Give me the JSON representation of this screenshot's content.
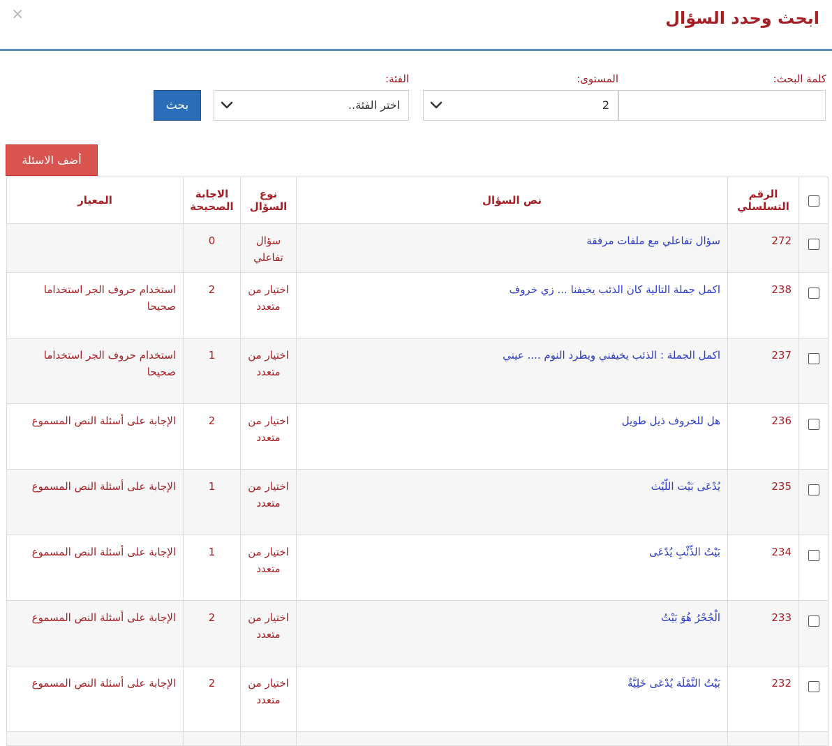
{
  "dialog": {
    "title": "ابحث وحدد السؤال",
    "close_glyph": "×"
  },
  "search": {
    "keyword_label": "كلمة البحث:",
    "keyword_value": "",
    "level_label": "المستوى:",
    "level_value": "2",
    "category_label": "الفئة:",
    "category_value": "اختر الفئة..",
    "search_button": "بحث"
  },
  "add_button": "أضف الاسئلة",
  "table": {
    "headers": {
      "serial": "الرقم التسلسلي",
      "question": "نص السؤال",
      "type": "نوع السؤال",
      "answer": "الاجابة الصحيحة",
      "criterion": "المعيار"
    },
    "rows": [
      {
        "serial": "272",
        "question": "سؤال تفاعلي مع ملفات مرفقة",
        "type": "سؤال تفاعلي",
        "answer": "0",
        "criterion": ""
      },
      {
        "serial": "238",
        "question": "اكمل جملة التالية كان الذئب يخيفنا ... زي خروف",
        "type": "اختيار من متعدد",
        "answer": "2",
        "criterion": "استخدام حروف الجر استخداما صحيحا"
      },
      {
        "serial": "237",
        "question": "اكمل الجملة : الذئب يخيفني ويطرد النوم .... عيني",
        "type": "اختيار من متعدد",
        "answer": "1",
        "criterion": "استخدام حروف الجر استخداما صحيحا"
      },
      {
        "serial": "236",
        "question": "هل للخروف ذيل طويل",
        "type": "اختيار من متعدد",
        "answer": "2",
        "criterion": "الإجابة على أسئلة النص المسموع"
      },
      {
        "serial": "235",
        "question": "يُدْعَى بَيْت اللّيْث",
        "type": "اختيار من متعدد",
        "answer": "1",
        "criterion": "الإجابة على أسئلة النص المسموع"
      },
      {
        "serial": "234",
        "question": "بَيْتُ الذِّئْبِ يُدْعَى",
        "type": "اختيار من متعدد",
        "answer": "1",
        "criterion": "الإجابة على أسئلة النص المسموع"
      },
      {
        "serial": "233",
        "question": "الْجُحْرُ هُوَ بَيْتُ",
        "type": "اختيار من متعدد",
        "answer": "2",
        "criterion": "الإجابة على أسئلة النص المسموع"
      },
      {
        "serial": "232",
        "question": "بَيْتُ النَّمْلَة يُدْعَى خَلِيَّةٌ",
        "type": "اختيار من متعدد",
        "answer": "2",
        "criterion": "الإجابة على أسئلة النص المسموع"
      }
    ]
  }
}
